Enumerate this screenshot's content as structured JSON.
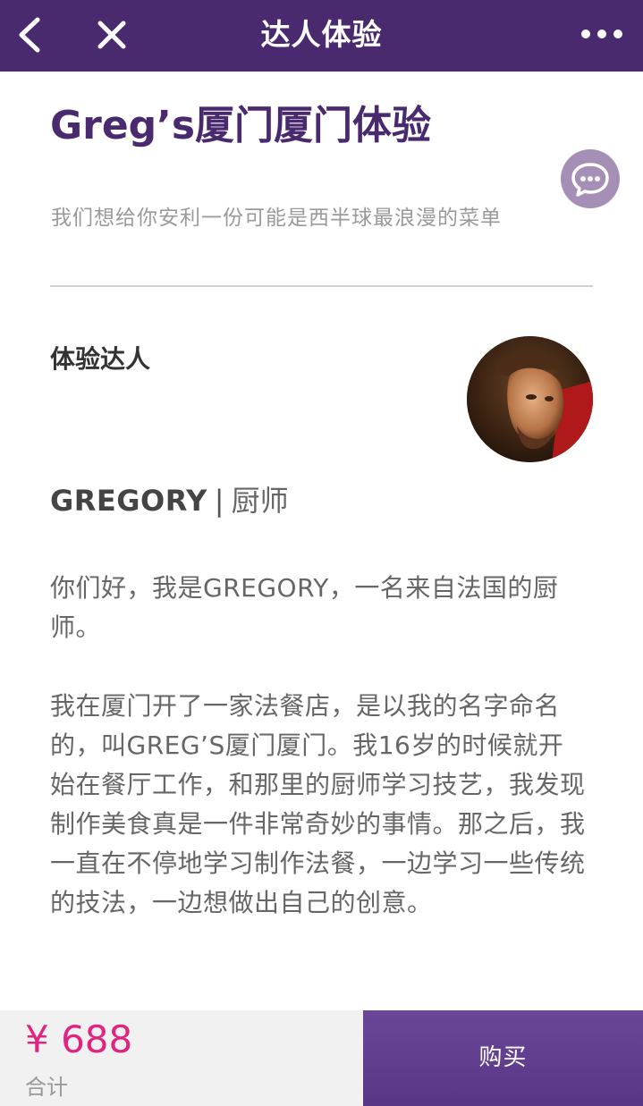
{
  "navbar": {
    "title": "达人体验",
    "back_icon": "chevron-left-icon",
    "close_icon": "close-icon",
    "more_icon": "more-dots-icon",
    "background": "#4a2a6e"
  },
  "experience": {
    "title": "Greg’s厦门厦门体验",
    "subtitle": "我们想给你安利一份可能是西半球最浪漫的菜单",
    "chat_icon": "chat-bubble-icon"
  },
  "host": {
    "section_label": "体验达人",
    "name": "GREGORY",
    "separator": "|",
    "role": "厨师"
  },
  "description": {
    "paragraphs": [
      "你们好，我是GREGORY，一名来自法国的厨师。",
      "我在厦门开了一家法餐店，是以我的名字命名的，叫GREG’S厦门厦门。我16岁的时候就开始在餐厅工作，和那里的厨师学习技艺，我发现制作美食真是一件非常奇妙的事情。那之后，我一直在不停地学习制作法餐，一边学习一些传统的技法，一边想做出自己的创意。"
    ]
  },
  "footer": {
    "price": "¥ 688",
    "total_label": "合计",
    "buy_label": "购买",
    "price_color": "#e2237f",
    "buy_color": "#5e3a8c"
  }
}
